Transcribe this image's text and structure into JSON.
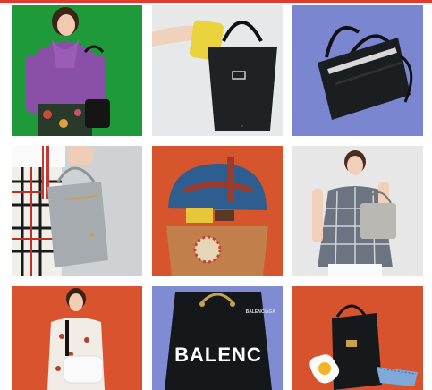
{
  "colors": {
    "accent_line": "#e23a2f",
    "tile_green": "#1f9a3b",
    "tile_light_gray": "#e6e8ea",
    "tile_periwinkle": "#7b86d0",
    "tile_orange": "#d6552d",
    "tile_pale_gray": "#e7e7e7"
  },
  "tiles": [
    {
      "label": "Woman in purple blouse with black bag on green background"
    },
    {
      "label": "Black tote bag with yellow item"
    },
    {
      "label": "Black structured handbag on purple background"
    },
    {
      "label": "Gray handbag with striped strap against plaid skirt"
    },
    {
      "label": "Blue and tan saddle bag with accessories on orange background"
    },
    {
      "label": "Woman holding silver tote bag"
    },
    {
      "label": "Woman with white crossbody bag on orange background"
    },
    {
      "label": "Black Balenciaga bag"
    },
    {
      "label": "Black bag with egg-shaped charm and blue pouch"
    }
  ],
  "balenciaga_text": "BALENC",
  "balenciaga_small": "BALENCIAGA"
}
